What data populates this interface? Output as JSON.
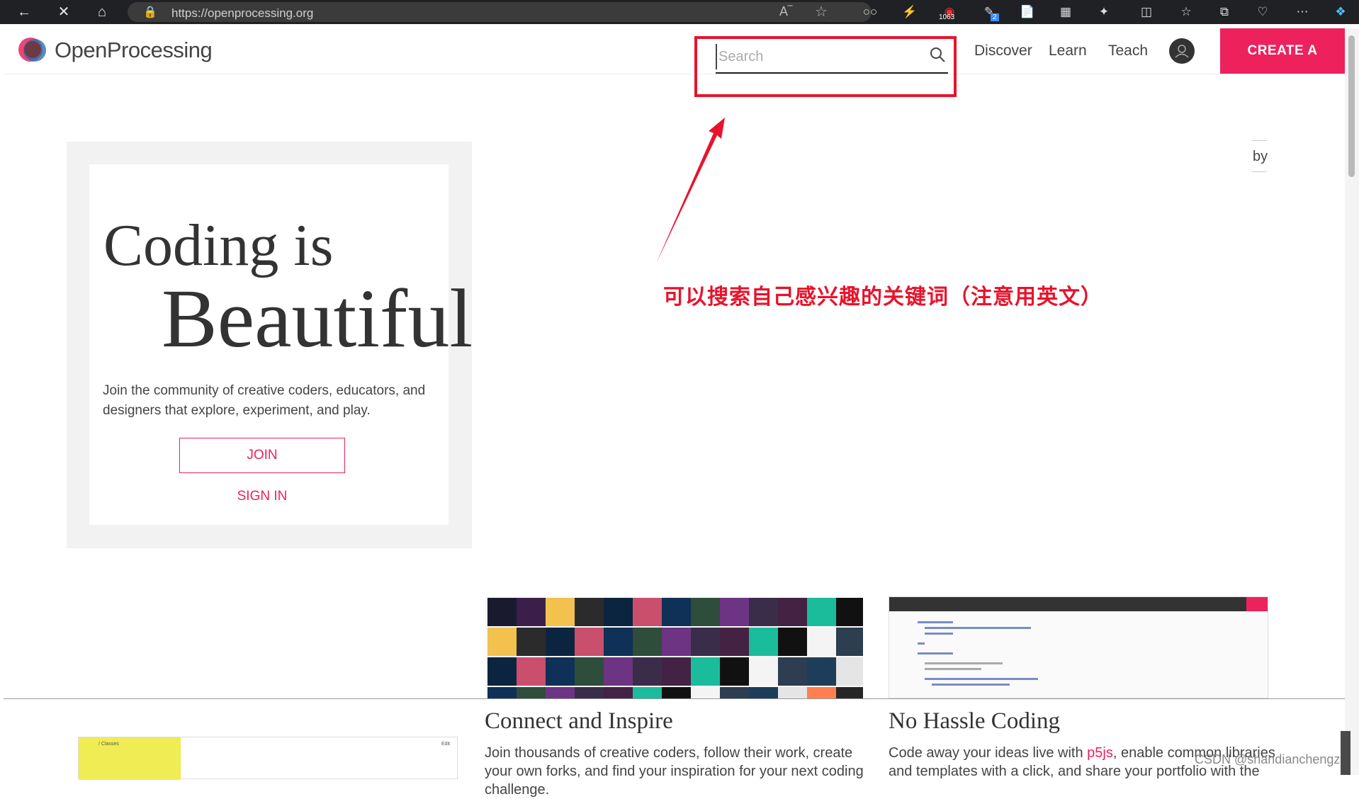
{
  "browser": {
    "url": "https://openprocessing.org",
    "badge_count": "1063",
    "badge_small": "2"
  },
  "header": {
    "logo_text": "OpenProcessing",
    "search_placeholder": "Search",
    "nav": [
      "Discover",
      "Learn",
      "Teach"
    ],
    "create_label": "CREATE A SKETCH"
  },
  "annotation": {
    "text": "可以搜索自己感兴趣的关键词（注意用英文）",
    "color": "#e8132b"
  },
  "hero": {
    "line1": "Coding is",
    "line2": "Beautiful",
    "description": "Join the community of creative coders, educators, and designers that explore, experiment, and play.",
    "join_label": "JOIN",
    "signin_label": "SIGN IN",
    "by_label": "by"
  },
  "features": [
    {
      "title": "Connect and Inspire",
      "description": "Join thousands of creative coders, follow their work, create your own forks, and find your inspiration for your next coding challenge."
    },
    {
      "title": "No Hassle Coding",
      "desc_before": "Code away your ideas live with ",
      "desc_link": "p5js",
      "desc_after": ", enable common libraries and templates with a click, and share your portfolio with the"
    }
  ],
  "classes_thumb": {
    "label": "/ Classes",
    "edit": "Edit"
  },
  "watermark": "CSDN @shandianchengzi",
  "colors": {
    "brand": "#ed225d",
    "annotation": "#e8132b"
  }
}
